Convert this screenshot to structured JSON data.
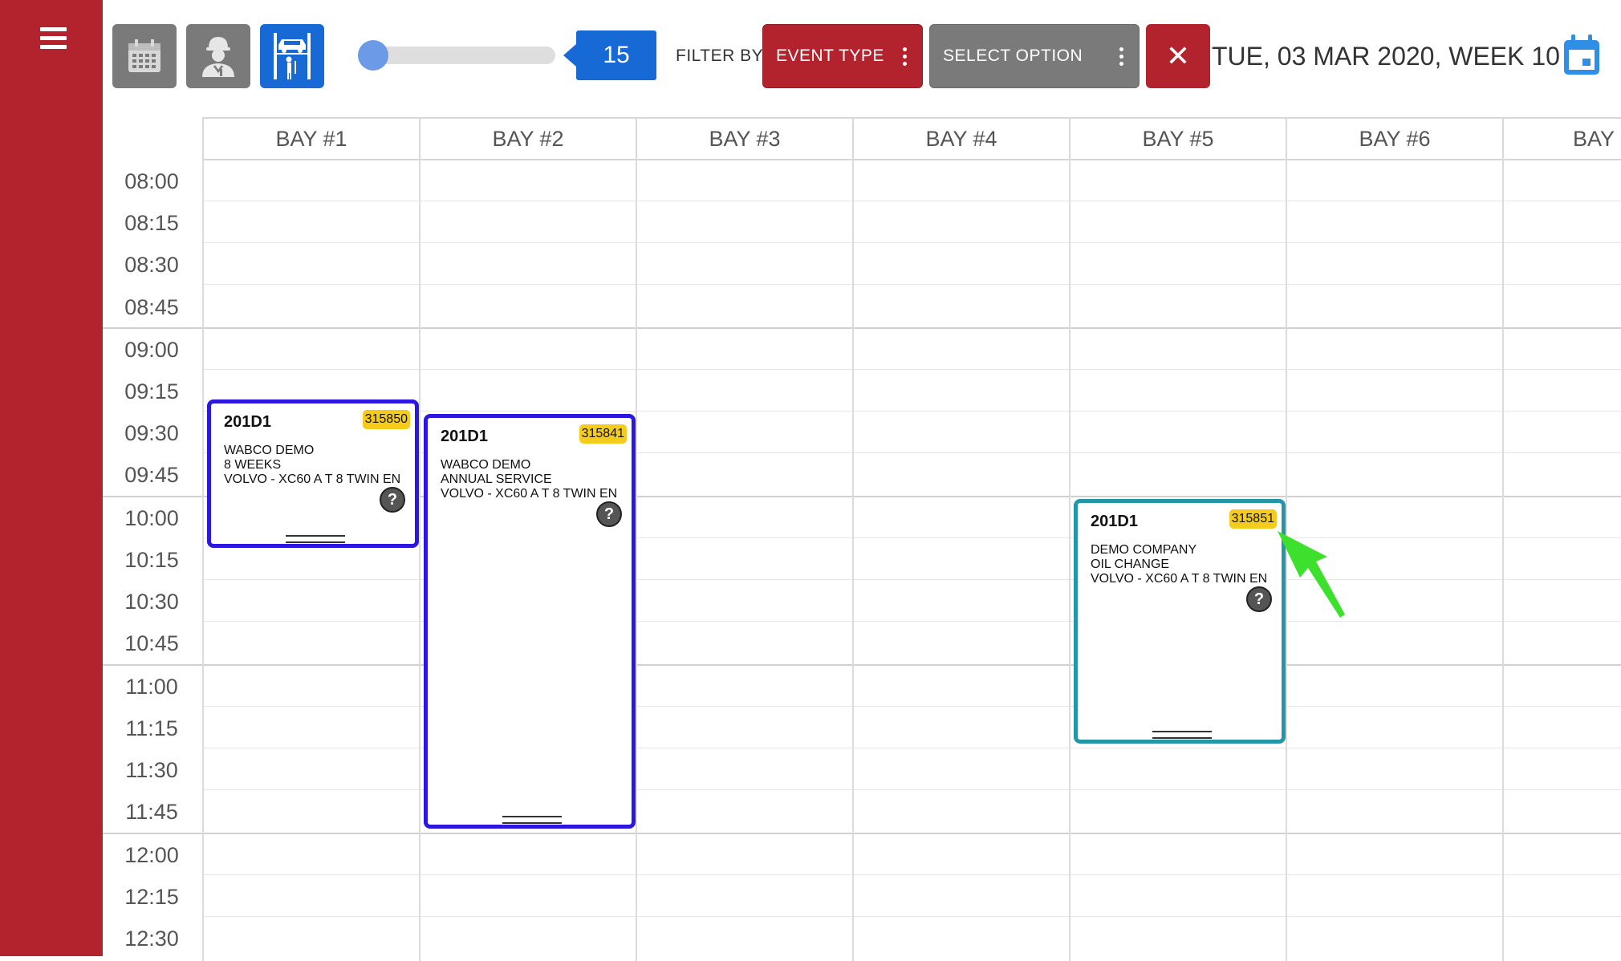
{
  "toolbar": {
    "slider_value": "15",
    "filter_label": "FILTER BY:",
    "event_type_label": "EVENT TYPE",
    "select_option_label": "SELECT OPTION",
    "clear_glyph": "✕",
    "date_label": "TUE, 03 MAR 2020, WEEK 10",
    "icons": [
      "menu-icon",
      "calendar-icon",
      "mechanic-icon",
      "vehicle-lift-icon",
      "calendar-icon"
    ]
  },
  "bays": [
    "BAY #1",
    "BAY #2",
    "BAY #3",
    "BAY #4",
    "BAY #5",
    "BAY #6",
    "BAY"
  ],
  "times": [
    "08:00",
    "08:15",
    "08:30",
    "08:45",
    "09:00",
    "09:15",
    "09:30",
    "09:45",
    "10:00",
    "10:15",
    "10:30",
    "10:45",
    "11:00",
    "11:15",
    "11:30",
    "11:45",
    "12:00",
    "12:15",
    "12:30"
  ],
  "events": [
    {
      "code": "201D1",
      "job_number": "315850",
      "customer": "WABCO DEMO",
      "service": "8 WEEKS",
      "vehicle": "VOLVO - XC60 A T 8 TWIN EN",
      "help": "?",
      "border_color": "#2b17e0"
    },
    {
      "code": "201D1",
      "job_number": "315841",
      "customer": "WABCO DEMO",
      "service": "ANNUAL SERVICE",
      "vehicle": "VOLVO - XC60 A T 8 TWIN EN",
      "help": "?",
      "border_color": "#2b17e0"
    },
    {
      "code": "201D1",
      "job_number": "315851",
      "customer": "DEMO COMPANY",
      "service": "OIL CHANGE",
      "vehicle": "VOLVO - XC60 A T 8 TWIN EN",
      "help": "?",
      "border_color": "#2596a8"
    }
  ],
  "annotation": {
    "arrow_color": "#3ee02e"
  },
  "colors": {
    "brand_red": "#b3232e",
    "active_blue": "#1769d6",
    "badge_yellow": "#f5cc1c"
  }
}
